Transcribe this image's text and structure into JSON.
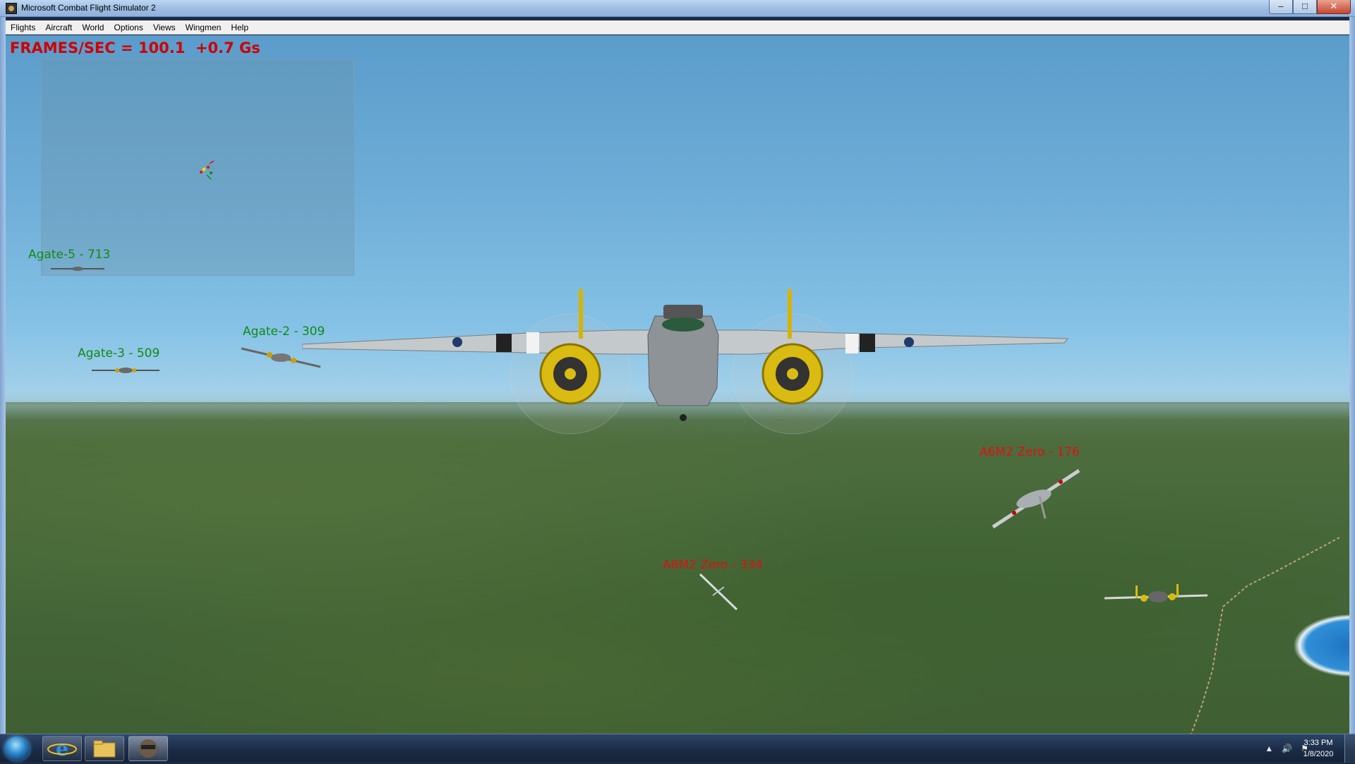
{
  "window": {
    "title": "Microsoft Combat Flight Simulator 2",
    "minimize_glyph": "–",
    "maximize_glyph": "□",
    "close_glyph": "✕"
  },
  "menu": {
    "items": [
      "Flights",
      "Aircraft",
      "World",
      "Options",
      "Views",
      "Wingmen",
      "Help"
    ]
  },
  "hud": {
    "fps_text": "FRAMES/SEC = 100.1  +0.7 Gs"
  },
  "labels": {
    "agate5": "Agate-5 - 713",
    "agate3": "Agate-3 - 509",
    "agate2": "Agate-2 - 309",
    "zero1": "A6M2 Zero - 176",
    "zero2": "A6M2 Zero - 334"
  },
  "colors": {
    "hud_red": "#d00000",
    "friendly_green": "#118a15",
    "enemy_red": "#e01010"
  },
  "taskbar": {
    "pinned": [
      "ie-icon",
      "explorer-icon",
      "cfs2-icon"
    ],
    "tray_up_glyph": "▲",
    "tray_volume_glyph": "🔊",
    "tray_flag_glyph": "⚑",
    "time": "3:33 PM",
    "date": "1/8/2020"
  }
}
